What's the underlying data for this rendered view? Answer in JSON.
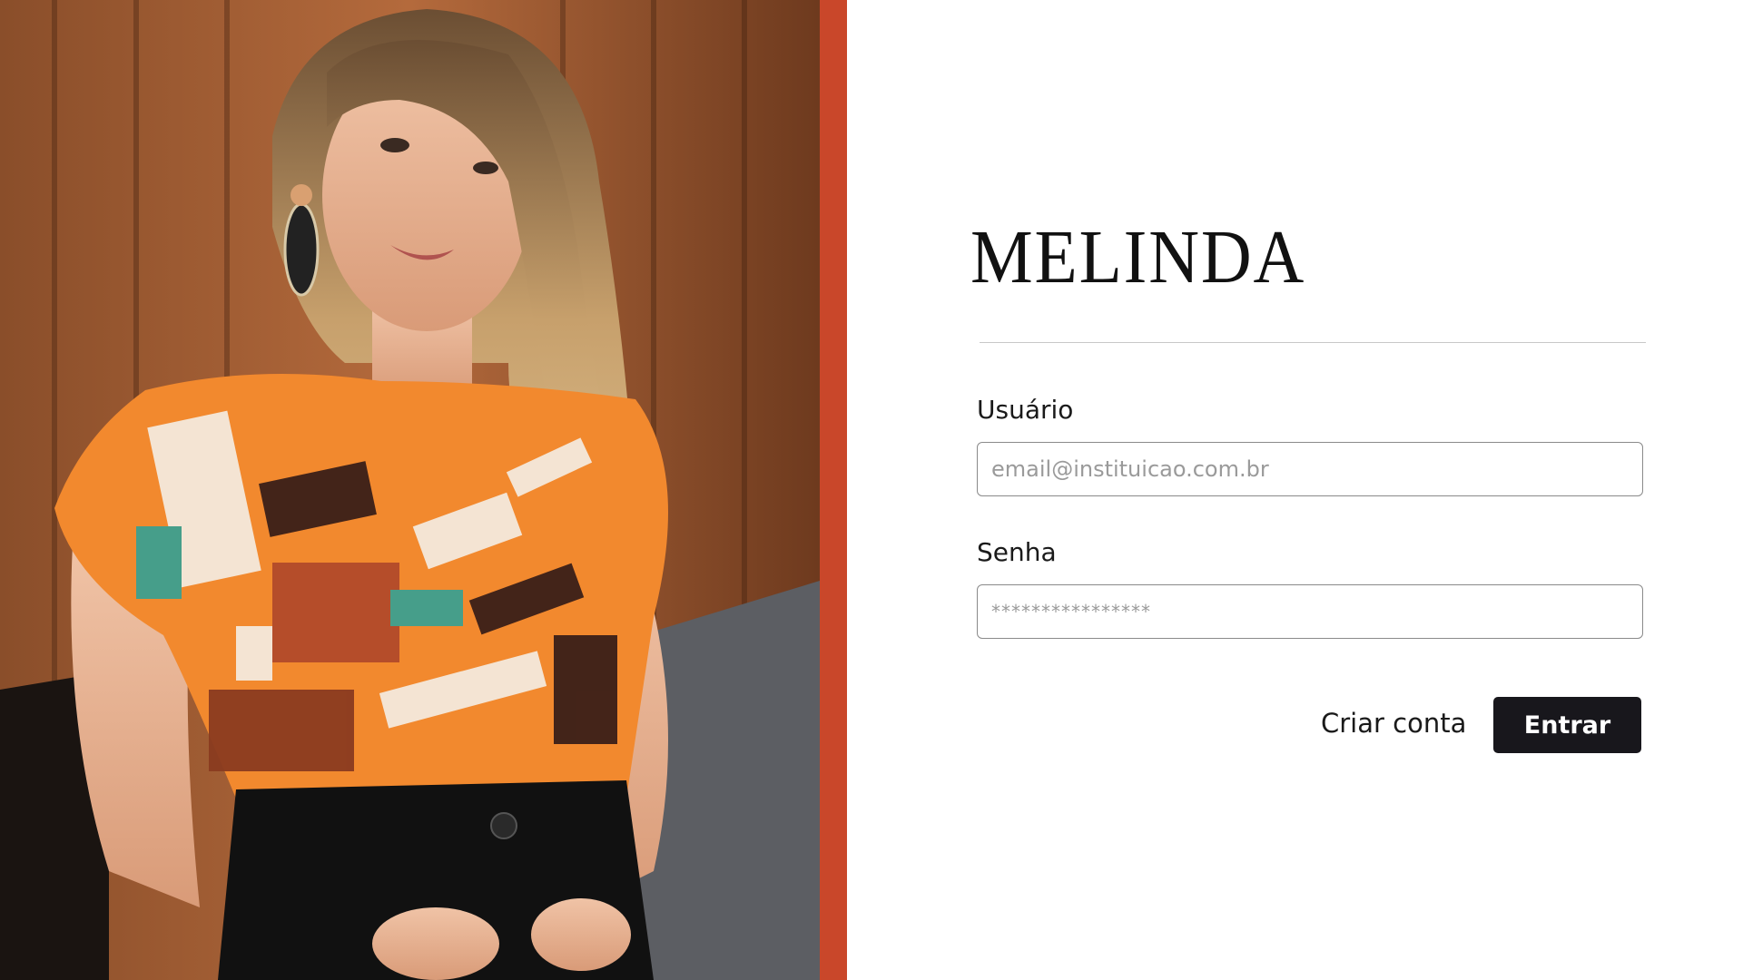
{
  "photo": {
    "description_icon": "fashion-model-photo"
  },
  "colors": {
    "accent": "#c9472a",
    "button_bg": "#18171c",
    "button_text": "#ffffff",
    "divider": "#c8c8c8"
  },
  "brand": {
    "name": "MELINDA"
  },
  "form": {
    "username_label": "Usuário",
    "username_placeholder": "email@instituicao.com.br",
    "password_label": "Senha",
    "password_placeholder": "****************",
    "create_account_label": "Criar conta",
    "submit_label": "Entrar"
  }
}
